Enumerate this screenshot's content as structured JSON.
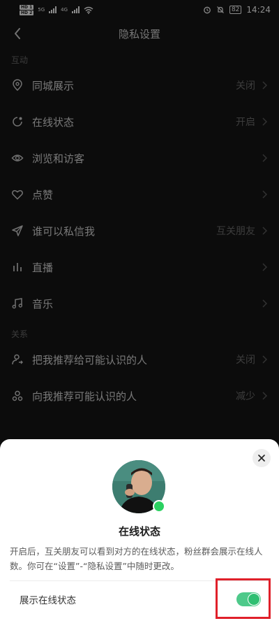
{
  "status_bar": {
    "hd1": "HD 1",
    "hd2": "HD 2",
    "net1": "5G",
    "net2": "4G",
    "battery": "82",
    "time": "14:24"
  },
  "nav": {
    "title": "隐私设置"
  },
  "sections": {
    "interaction": "互动",
    "relations": "关系"
  },
  "rows": [
    {
      "label": "同城展示",
      "value": "关闭",
      "icon": "location-pin-icon"
    },
    {
      "label": "在线状态",
      "value": "开启",
      "icon": "online-status-icon"
    },
    {
      "label": "浏览和访客",
      "value": "",
      "icon": "eye-icon"
    },
    {
      "label": "点赞",
      "value": "",
      "icon": "heart-icon"
    },
    {
      "label": "谁可以私信我",
      "value": "互关朋友",
      "icon": "send-icon"
    },
    {
      "label": "直播",
      "value": "",
      "icon": "live-bars-icon"
    },
    {
      "label": "音乐",
      "value": "",
      "icon": "music-note-icon"
    },
    {
      "label": "把我推荐给可能认识的人",
      "value": "关闭",
      "icon": "recommend-me-icon"
    },
    {
      "label": "向我推荐可能认识的人",
      "value": "减少",
      "icon": "recommend-to-me-icon"
    }
  ],
  "sheet": {
    "title": "在线状态",
    "description": "开启后，互关朋友可以看到对方的在线状态，粉丝群会展示在线人数。你可在“设置”-“隐私设置”中随时更改。",
    "toggle_label": "展示在线状态",
    "toggle_on": true
  },
  "colors": {
    "background": "#161616",
    "accent_green": "#2bd161",
    "highlight_red": "#e0202a"
  }
}
